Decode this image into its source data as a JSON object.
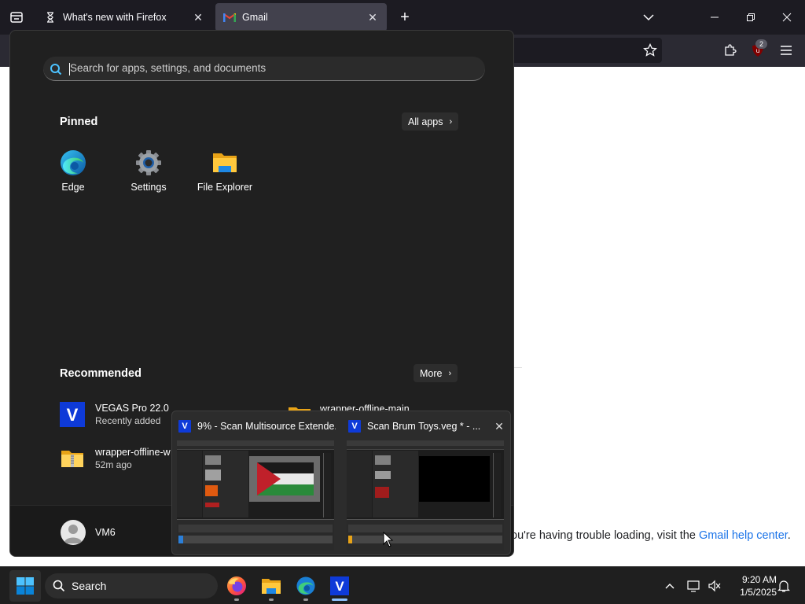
{
  "browser": {
    "tabs": [
      {
        "label": "What's new with Firefox",
        "icon": "firefox-hourglass-icon",
        "active": false
      },
      {
        "label": "Gmail",
        "icon": "gmail-icon",
        "active": true
      }
    ],
    "toolbar_badge": "2"
  },
  "page": {
    "help_prefix": "ou're having trouble loading, visit the ",
    "help_link": "Gmail help center",
    "help_suffix": "."
  },
  "start_menu": {
    "search_placeholder": "Search for apps, settings, and documents",
    "pinned_title": "Pinned",
    "all_apps_label": "All apps",
    "pinned": [
      {
        "label": "Edge",
        "icon": "edge-icon"
      },
      {
        "label": "Settings",
        "icon": "settings-gear-icon"
      },
      {
        "label": "File Explorer",
        "icon": "folder-icon"
      }
    ],
    "recommended_title": "Recommended",
    "more_label": "More",
    "recommended": [
      {
        "name": "VEGAS Pro 22.0",
        "sub": "Recently added",
        "icon": "vegas-icon"
      },
      {
        "name": "wrapper-offline-w",
        "sub": "52m ago",
        "icon": "zip-folder-icon"
      }
    ],
    "partial_item": "wrapper-offline-main",
    "user_name": "VM6"
  },
  "thumbnails": [
    {
      "title": "9% - Scan Multisource Extende...",
      "icon": "vegas-icon"
    },
    {
      "title": "Scan Brum Toys.veg * - ...",
      "icon": "vegas-icon"
    }
  ],
  "taskbar": {
    "search_label": "Search",
    "apps": [
      "firefox-icon",
      "file-explorer-icon",
      "edge-icon",
      "vegas-icon"
    ],
    "time": "9:20 AM",
    "date": "1/5/2025"
  },
  "colors": {
    "start_bg": "#202020",
    "taskbar_bg": "#1f1f1f",
    "accent": "#0078d4",
    "link": "#1a73e8",
    "vegas_blue": "#0e3ad8"
  }
}
